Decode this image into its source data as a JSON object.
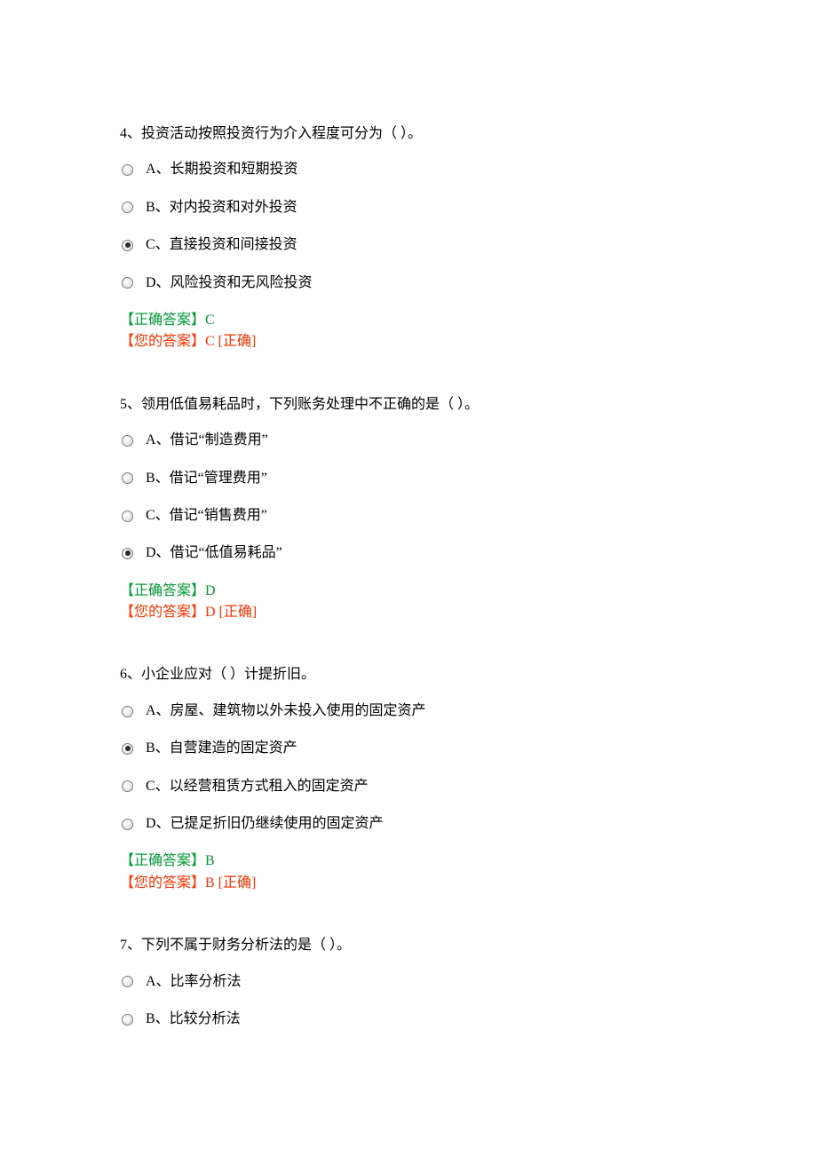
{
  "questions": [
    {
      "text": "4、投资活动按照投资行为介入程度可分为（  ）。",
      "options": [
        {
          "label": "A、长期投资和短期投资",
          "selected": false
        },
        {
          "label": "B、对内投资和对外投资",
          "selected": false
        },
        {
          "label": "C、直接投资和间接投资",
          "selected": true
        },
        {
          "label": "D、风险投资和无风险投资",
          "selected": false
        }
      ],
      "correct": "【正确答案】C",
      "yours": "【您的答案】C [正确]"
    },
    {
      "text": "5、领用低值易耗品时，下列账务处理中不正确的是（  ）。",
      "options": [
        {
          "label": "A、借记“制造费用”",
          "selected": false
        },
        {
          "label": "B、借记“管理费用”",
          "selected": false
        },
        {
          "label": "C、借记“销售费用”",
          "selected": false
        },
        {
          "label": "D、借记“低值易耗品”",
          "selected": true
        }
      ],
      "correct": "【正确答案】D",
      "yours": "【您的答案】D [正确]"
    },
    {
      "text": "6、小企业应对（  ）计提折旧。",
      "options": [
        {
          "label": "A、房屋、建筑物以外未投入使用的固定资产",
          "selected": false
        },
        {
          "label": "B、自营建造的固定资产",
          "selected": true
        },
        {
          "label": "C、以经营租赁方式租入的固定资产",
          "selected": false
        },
        {
          "label": "D、已提足折旧仍继续使用的固定资产",
          "selected": false
        }
      ],
      "correct": "【正确答案】B",
      "yours": "【您的答案】B [正确]"
    },
    {
      "text": "7、下列不属于财务分析法的是（  ）。",
      "options": [
        {
          "label": "A、比率分析法",
          "selected": false
        },
        {
          "label": "B、比较分析法",
          "selected": false
        }
      ],
      "correct": "",
      "yours": ""
    }
  ]
}
